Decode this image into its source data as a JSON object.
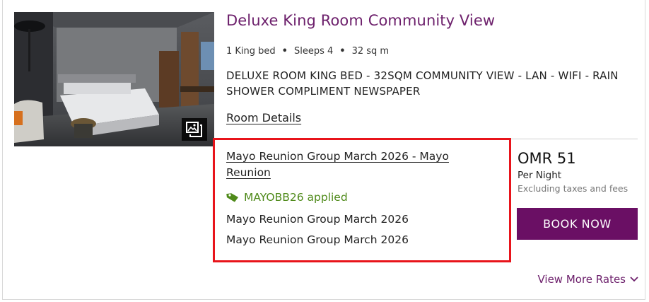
{
  "room": {
    "title": "Deluxe King Room Community View",
    "beds": "1 King bed",
    "sleeps": "Sleeps 4",
    "size": "32 sq m",
    "separator": "•",
    "description": "DELUXE ROOM KING BED - 32SQM COMMUNITY VIEW - LAN - WIFI - RAIN SHOWER COMPLIMENT NEWSPAPER",
    "details_link": "Room Details"
  },
  "rate": {
    "name": "Mayo Reunion Group March 2026 - Mayo Reunion",
    "promo_text": "MAYOBB26 applied",
    "line_1": "Mayo Reunion Group March 2026",
    "line_2": "Mayo Reunion Group March 2026"
  },
  "price": {
    "amount": "OMR 51",
    "per": "Per Night",
    "note": "Excluding taxes and fees",
    "book_label": "BOOK NOW"
  },
  "more_rates_label": "View More Rates",
  "colors": {
    "brand_purple": "#6a0f64",
    "title_purple": "#6c1f6b",
    "promo_green": "#4f8a1a",
    "highlight_red": "#e8141b"
  },
  "icons": {
    "gallery": "gallery-icon",
    "promo": "tag-icon",
    "more": "chevron-down-icon"
  }
}
